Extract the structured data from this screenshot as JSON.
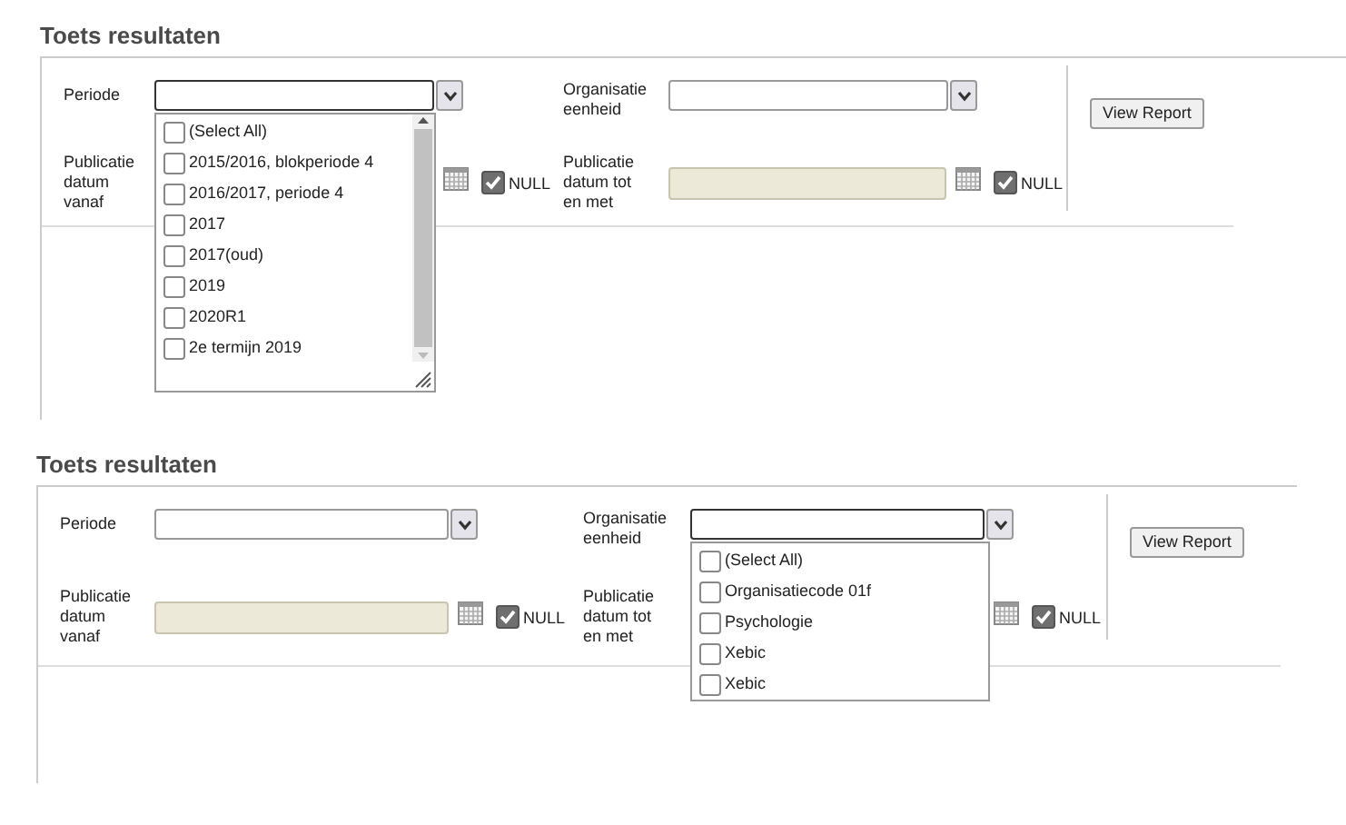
{
  "panels": [
    {
      "title": "Toets resultaten",
      "periode": {
        "label": "Periode",
        "expanded": true,
        "options": [
          {
            "label": "(Select All)",
            "checked": false
          },
          {
            "label": "2015/2016, blokperiode 4",
            "checked": false
          },
          {
            "label": "2016/2017, periode 4",
            "checked": false
          },
          {
            "label": "2017",
            "checked": false
          },
          {
            "label": "2017(oud)",
            "checked": false
          },
          {
            "label": "2019",
            "checked": false
          },
          {
            "label": "2020R1",
            "checked": false
          },
          {
            "label": "2e termijn 2019",
            "checked": false
          }
        ]
      },
      "organisatie": {
        "label": "Organisatie eenheid",
        "expanded": false
      },
      "date_from": {
        "label": "Publicatie datum vanaf",
        "null_checked": true,
        "null_label": "NULL"
      },
      "date_to": {
        "label": "Publicatie datum tot en met",
        "null_checked": true,
        "null_label": "NULL"
      },
      "button": "View Report"
    },
    {
      "title": "Toets resultaten",
      "periode": {
        "label": "Periode",
        "expanded": false
      },
      "organisatie": {
        "label": "Organisatie eenheid",
        "expanded": true,
        "options": [
          {
            "label": "(Select All)",
            "checked": false
          },
          {
            "label": "Organisatiecode 01f",
            "checked": false
          },
          {
            "label": "Psychologie",
            "checked": false
          },
          {
            "label": "Xebic",
            "checked": false
          },
          {
            "label": "Xebic",
            "checked": false
          }
        ]
      },
      "date_from": {
        "label": "Publicatie datum vanaf",
        "null_checked": true,
        "null_label": "NULL"
      },
      "date_to": {
        "label": "Publicatie datum tot en met",
        "null_checked": true,
        "null_label": "NULL"
      },
      "button": "View Report"
    }
  ]
}
